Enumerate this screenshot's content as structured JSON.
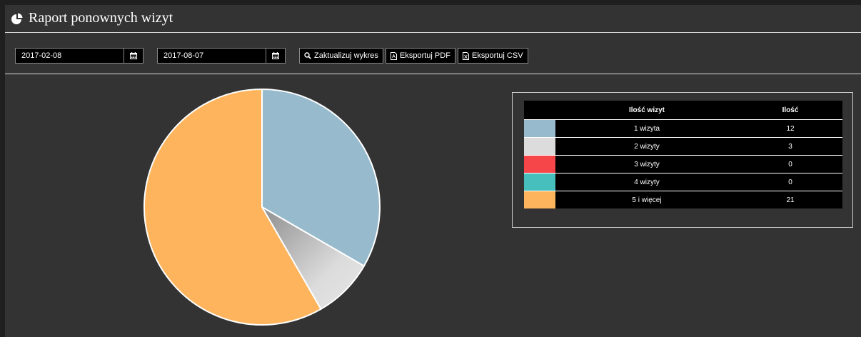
{
  "header": {
    "title": "Raport ponownych wizyt",
    "icon": "pie-chart-icon"
  },
  "toolbar": {
    "date_from": "2017-02-08",
    "date_to": "2017-08-07",
    "calendar_icon": "calendar-icon",
    "update_label": "Zaktualizuj wykres",
    "pdf_label": "Eksportuj PDF",
    "csv_label": "Eksportuj CSV"
  },
  "legend_table": {
    "headers": [
      "",
      "Ilość wizyt",
      "Ilość"
    ]
  },
  "chart_data": {
    "type": "pie",
    "categories": [
      "1 wizyta",
      "2 wizyty",
      "3 wizyty",
      "4 wizyty",
      "5 i więcej"
    ],
    "values": [
      12,
      3,
      0,
      0,
      21
    ],
    "colors": [
      "#97bbcd",
      "#dcdcdc",
      "#f7464a",
      "#46bfbd",
      "#fdb45c"
    ],
    "legend_position": "right"
  }
}
